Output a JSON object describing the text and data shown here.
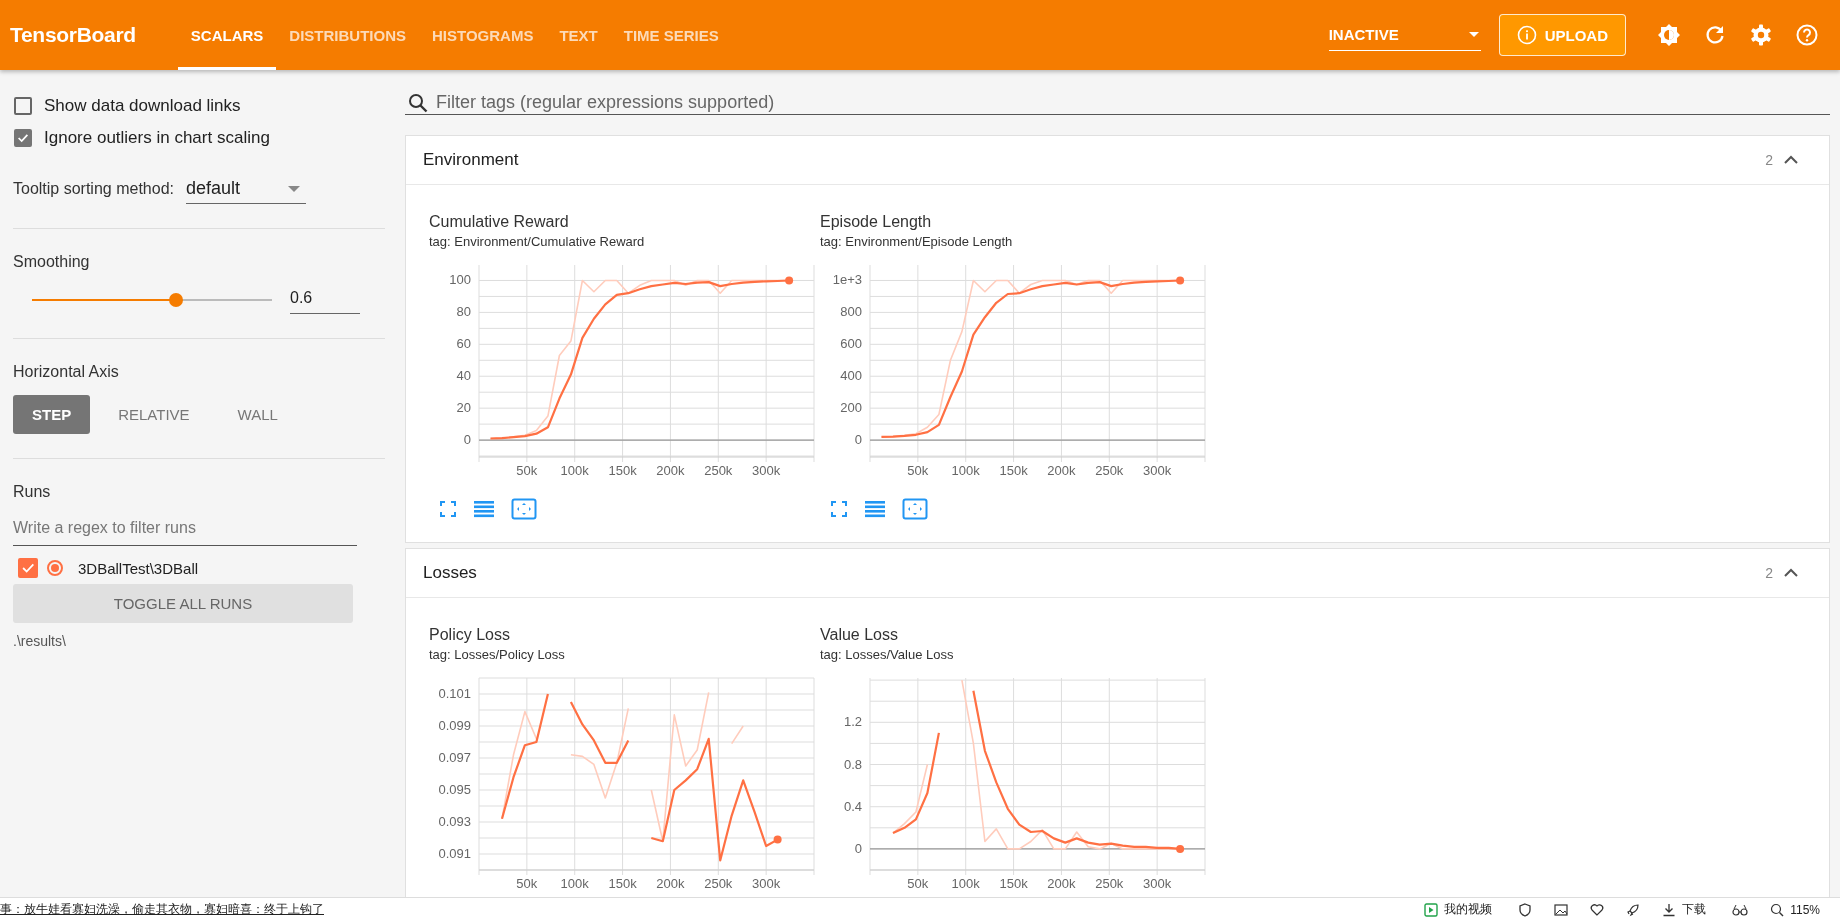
{
  "header": {
    "logo": "TensorBoard",
    "tabs": [
      {
        "label": "SCALARS",
        "selected": true
      },
      {
        "label": "DISTRIBUTIONS",
        "selected": false
      },
      {
        "label": "HISTOGRAMS",
        "selected": false
      },
      {
        "label": "TEXT",
        "selected": false
      },
      {
        "label": "TIME SERIES",
        "selected": false
      }
    ],
    "run_state": "INACTIVE",
    "upload_button": "UPLOAD"
  },
  "sidebar": {
    "options": [
      {
        "label": "Show data download links",
        "checked": false
      },
      {
        "label": "Ignore outliers in chart scaling",
        "checked": true
      }
    ],
    "tooltip_sorting": {
      "label": "Tooltip sorting method:",
      "value": "default"
    },
    "smoothing": {
      "label": "Smoothing",
      "level": 0.6,
      "value": "0.6"
    },
    "horizontal_axis": {
      "label": "Horizontal Axis",
      "options": [
        {
          "label": "STEP",
          "selected": true
        },
        {
          "label": "RELATIVE",
          "selected": false
        },
        {
          "label": "WALL",
          "selected": false
        }
      ]
    },
    "runs": {
      "label": "Runs",
      "filter_placeholder": "Write a regex to filter runs",
      "items": [
        {
          "name": "3DBallTest\\3DBall",
          "checked": true,
          "color": "#ff7043"
        }
      ],
      "toggle_button": "TOGGLE ALL RUNS",
      "log_dir": ".\\results\\"
    }
  },
  "main": {
    "filter_placeholder": "Filter tags (regular expressions supported)",
    "groups": [
      {
        "title": "Environment",
        "count": "2",
        "expanded": true,
        "charts": [
          {
            "title": "Cumulative Reward",
            "tag": "tag: Environment/Cumulative Reward",
            "toolbar": true,
            "chart_data": {
              "type": "line",
              "grid": true,
              "x": [
                12000,
                24000,
                36000,
                48000,
                60000,
                72000,
                84000,
                96000,
                108000,
                120000,
                132000,
                144000,
                156000,
                168000,
                180000,
                192000,
                204000,
                216000,
                228000,
                240000,
                252000,
                264000,
                276000,
                288000,
                300000,
                312000,
                324000
              ],
              "xlim": [
                0,
                350000
              ],
              "ylim": [
                -10.6,
                109.7
              ],
              "xticks": [
                {
                  "value": 50000,
                  "label": "50k"
                },
                {
                  "value": 100000,
                  "label": "100k"
                },
                {
                  "value": 150000,
                  "label": "150k"
                },
                {
                  "value": 200000,
                  "label": "200k"
                },
                {
                  "value": 250000,
                  "label": "250k"
                },
                {
                  "value": 300000,
                  "label": "300k"
                }
              ],
              "yticks": [
                0,
                20,
                40,
                60,
                80,
                100
              ],
              "series": [
                {
                  "color": "#ffccbc",
                  "values": [
                    1,
                    1.3,
                    2,
                    3,
                    6,
                    15,
                    53,
                    62,
                    100,
                    93,
                    100,
                    100,
                    92,
                    97,
                    100,
                    100,
                    100,
                    97,
                    100,
                    100,
                    92,
                    100,
                    100,
                    100,
                    100,
                    100,
                    100
                  ]
                },
                {
                  "color": "#ff7043",
                  "values": [
                    1,
                    1.2,
                    1.8,
                    2.5,
                    4,
                    8,
                    26,
                    41,
                    64,
                    76,
                    85,
                    91,
                    92,
                    94.5,
                    96.5,
                    97.5,
                    98.5,
                    97.8,
                    98.7,
                    99,
                    96.5,
                    97.8,
                    98.7,
                    99.2,
                    99.5,
                    99.7,
                    100
                  ]
                }
              ]
            }
          },
          {
            "title": "Episode Length",
            "tag": "tag: Environment/Episode Length",
            "toolbar": true,
            "chart_data": {
              "type": "line",
              "grid": true,
              "x": [
                12000,
                24000,
                36000,
                48000,
                60000,
                72000,
                84000,
                96000,
                108000,
                120000,
                132000,
                144000,
                156000,
                168000,
                180000,
                192000,
                204000,
                216000,
                228000,
                240000,
                252000,
                264000,
                276000,
                288000,
                300000,
                312000,
                324000
              ],
              "xlim": [
                0,
                350000
              ],
              "ylim": [
                -106,
                1097
              ],
              "xticks": [
                {
                  "value": 50000,
                  "label": "50k"
                },
                {
                  "value": 100000,
                  "label": "100k"
                },
                {
                  "value": 150000,
                  "label": "150k"
                },
                {
                  "value": 200000,
                  "label": "200k"
                },
                {
                  "value": 250000,
                  "label": "250k"
                },
                {
                  "value": 300000,
                  "label": "300k"
                }
              ],
              "yticks": [
                0,
                200,
                400,
                600,
                800,
                {
                  "value": 1000,
                  "label": "1e+3"
                }
              ],
              "series": [
                {
                  "color": "#ffccbc",
                  "values": [
                    20,
                    22,
                    30,
                    40,
                    80,
                    160,
                    500,
                    680,
                    1000,
                    930,
                    1000,
                    1000,
                    920,
                    975,
                    1000,
                    1000,
                    1000,
                    975,
                    1000,
                    1000,
                    920,
                    1000,
                    1000,
                    1000,
                    1000,
                    1000,
                    1000
                  ]
                },
                {
                  "color": "#ff7043",
                  "values": [
                    20,
                    22,
                    26,
                    33,
                    50,
                    95,
                    270,
                    430,
                    660,
                    770,
                    860,
                    915,
                    920,
                    945,
                    965,
                    975,
                    985,
                    975,
                    985,
                    990,
                    965,
                    978,
                    987,
                    992,
                    995,
                    997,
                    1000
                  ]
                }
              ]
            }
          }
        ]
      },
      {
        "title": "Losses",
        "count": "2",
        "expanded": true,
        "charts": [
          {
            "title": "Policy Loss",
            "tag": "tag: Losses/Policy Loss",
            "toolbar": false,
            "chart_data": {
              "type": "line",
              "grid": true,
              "x": [
                24000,
                36000,
                48000,
                60000,
                72000,
                96000,
                108000,
                120000,
                132000,
                144000,
                156000,
                180000,
                192000,
                204000,
                216000,
                228000,
                240000,
                252000,
                264000,
                276000,
                288000,
                300000,
                312000
              ],
              "xlim": [
                0,
                350000
              ],
              "ylim": [
                0.09,
                0.102
              ],
              "xticks": [
                {
                  "value": 50000,
                  "label": "50k"
                },
                {
                  "value": 100000,
                  "label": "100k"
                },
                {
                  "value": 150000,
                  "label": "150k"
                },
                {
                  "value": 200000,
                  "label": "200k"
                },
                {
                  "value": 250000,
                  "label": "250k"
                },
                {
                  "value": 300000,
                  "label": "300k"
                }
              ],
              "yticks": [
                0.091,
                0.093,
                0.095,
                0.097,
                0.099,
                0.101
              ],
              "series": [
                {
                  "color": "#ffccbc",
                  "values": [
                    0.0932,
                    0.0972,
                    0.0999,
                    0.0982,
                    null,
                    0.0972,
                    0.0971,
                    0.0966,
                    0.0945,
                    0.0967,
                    0.1001,
                    0.095,
                    0.0918,
                    0.0997,
                    0.0965,
                    0.0975,
                    0.1011,
                    null,
                    0.0979,
                    0.099,
                    null,
                    null,
                    null
                  ]
                },
                {
                  "color": "#ff7043",
                  "values": [
                    0.0932,
                    0.0958,
                    0.0978,
                    0.098,
                    0.101,
                    0.1005,
                    0.0991,
                    0.0981,
                    0.0967,
                    0.0967,
                    0.0981,
                    0.092,
                    0.0918,
                    0.095,
                    0.0956,
                    0.0963,
                    0.0982,
                    0.0906,
                    0.0934,
                    0.0956,
                    0.0936,
                    0.0915,
                    0.0919
                  ]
                }
              ]
            }
          },
          {
            "title": "Value Loss",
            "tag": "tag: Losses/Value Loss",
            "toolbar": false,
            "chart_data": {
              "type": "line",
              "grid": true,
              "x": [
                24000,
                36000,
                48000,
                60000,
                72000,
                96000,
                108000,
                120000,
                132000,
                144000,
                156000,
                168000,
                180000,
                192000,
                204000,
                216000,
                228000,
                240000,
                252000,
                264000,
                276000,
                288000,
                300000,
                312000,
                324000
              ],
              "xlim": [
                0,
                350000
              ],
              "ylim": [
                -0.2,
                1.62
              ],
              "xticks": [
                {
                  "value": 50000,
                  "label": "50k"
                },
                {
                  "value": 100000,
                  "label": "100k"
                },
                {
                  "value": 150000,
                  "label": "150k"
                },
                {
                  "value": 200000,
                  "label": "200k"
                },
                {
                  "value": 250000,
                  "label": "250k"
                },
                {
                  "value": 300000,
                  "label": "300k"
                }
              ],
              "yticks": [
                0,
                0.4,
                0.8,
                1.2
              ],
              "series": [
                {
                  "color": "#ffccbc",
                  "values": [
                    0.15,
                    0.24,
                    0.35,
                    0.8,
                    null,
                    1.6,
                    1.0,
                    0.07,
                    0.19,
                    0,
                    0,
                    0.07,
                    0.18,
                    0,
                    0,
                    0.16,
                    0.02,
                    0,
                    0.05,
                    0,
                    0,
                    0,
                    0,
                    0,
                    0
                  ]
                },
                {
                  "color": "#ff7043",
                  "values": [
                    0.15,
                    0.2,
                    0.28,
                    0.53,
                    1.1,
                    null,
                    1.5,
                    0.93,
                    0.63,
                    0.38,
                    0.23,
                    0.16,
                    0.17,
                    0.1,
                    0.06,
                    0.1,
                    0.06,
                    0.04,
                    0.05,
                    0.03,
                    0.02,
                    0.02,
                    0.01,
                    0.01,
                    0
                  ]
                }
              ]
            }
          }
        ]
      }
    ]
  },
  "status_bar": {
    "news_link": "事：放牛娃看寡妇洗澡，偷走其衣物，寡妇暗喜：终于上钩了",
    "video_label": "我的视频",
    "download_label": "下载",
    "zoom": "115%"
  }
}
